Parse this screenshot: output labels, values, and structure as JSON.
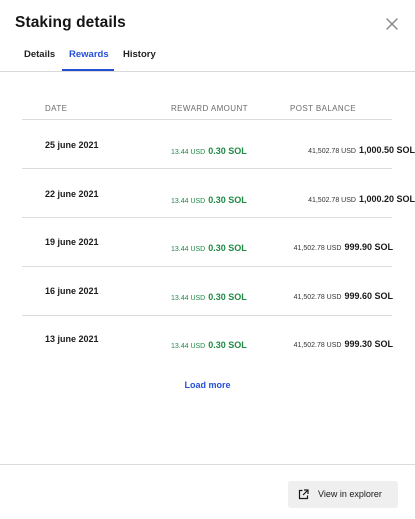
{
  "header": {
    "title": "Staking details"
  },
  "tabs": [
    {
      "label": "Details",
      "active": false
    },
    {
      "label": "Rewards",
      "active": true
    },
    {
      "label": "History",
      "active": false
    }
  ],
  "table": {
    "columns": [
      "DATE",
      "REWARD AMOUNT",
      "POST BALANCE"
    ],
    "rows": [
      {
        "date": "25 june 2021",
        "reward_usd": "13.44 USD",
        "reward_sol": "0.30 SOL",
        "balance_usd": "41,502.78 USD",
        "balance_sol": "1,000.50 SOL"
      },
      {
        "date": "22 june 2021",
        "reward_usd": "13.44 USD",
        "reward_sol": "0.30 SOL",
        "balance_usd": "41,502.78 USD",
        "balance_sol": "1,000.20 SOL"
      },
      {
        "date": "19 june 2021",
        "reward_usd": "13.44 USD",
        "reward_sol": "0.30 SOL",
        "balance_usd": "41,502.78 USD",
        "balance_sol": "999.90 SOL"
      },
      {
        "date": "16 june 2021",
        "reward_usd": "13.44 USD",
        "reward_sol": "0.30 SOL",
        "balance_usd": "41,502.78 USD",
        "balance_sol": "999.60 SOL"
      },
      {
        "date": "13 june 2021",
        "reward_usd": "13.44 USD",
        "reward_sol": "0.30 SOL",
        "balance_usd": "41,502.78 USD",
        "balance_sol": "999.30 SOL"
      }
    ]
  },
  "load_more": "Load more",
  "footer": {
    "explorer_label": "View in explorer",
    "explorer_icon": "external-link-icon"
  },
  "colors": {
    "accent": "#2450d8",
    "reward_green": "#1f8a45",
    "button_bg": "#efefef"
  }
}
